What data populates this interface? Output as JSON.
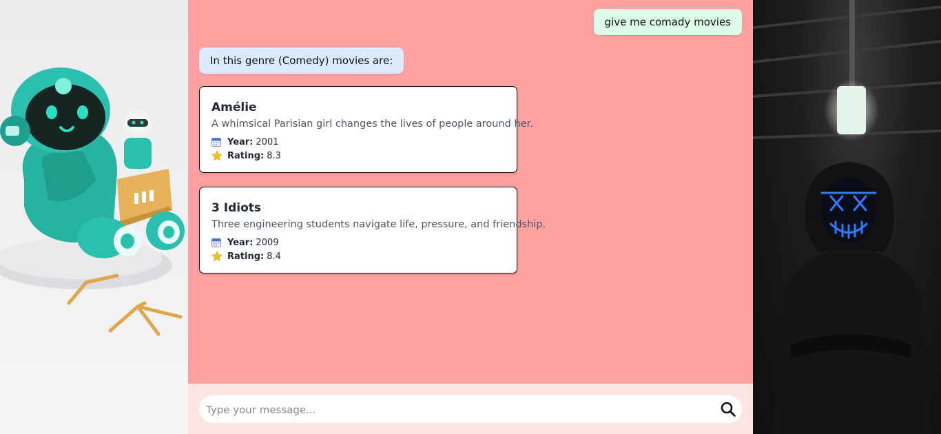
{
  "chat": {
    "user_message": "give me comady movies",
    "bot_message": "In this genre (Comedy) movies are:",
    "movies": [
      {
        "title": "Amélie",
        "description": "A whimsical Parisian girl changes the lives of people around her.",
        "year_label": "Year:",
        "year": "2001",
        "rating_label": "Rating:",
        "rating": "8.3"
      },
      {
        "title": "3 Idiots",
        "description": "Three engineering students navigate life, pressure, and friendship.",
        "year_label": "Year:",
        "year": "2009",
        "rating_label": "Rating:",
        "rating": "8.4"
      }
    ]
  },
  "composer": {
    "placeholder": "Type your message...",
    "send_icon": "search-icon"
  },
  "colors": {
    "chat_background": "#ffa1a1",
    "composer_background": "#ffe4e4",
    "user_bubble": "#dcfce7",
    "bot_bubble": "#dbeafe"
  }
}
